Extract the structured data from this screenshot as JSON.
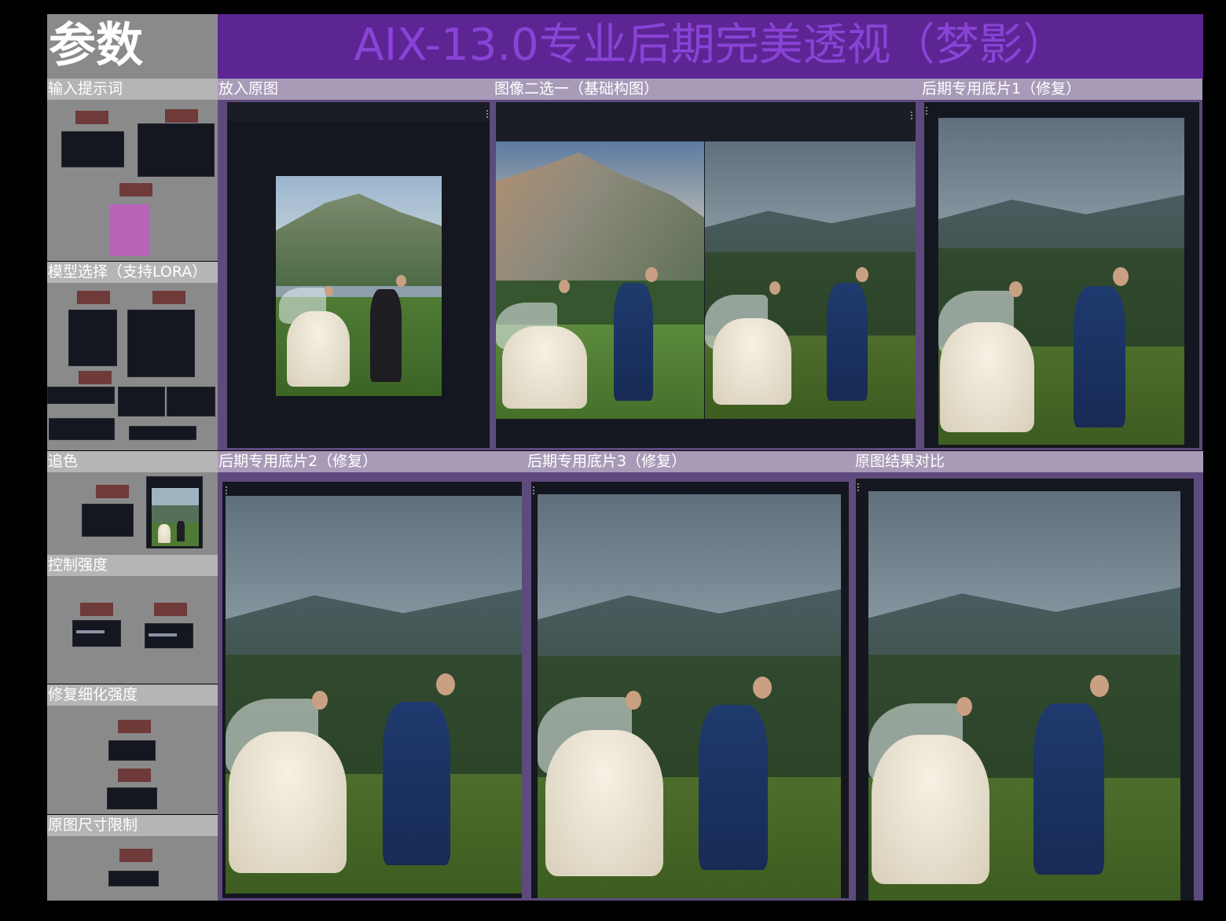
{
  "header": {
    "params_title": "参数",
    "main_title": "AIX-13.0专业后期完美透视（梦影）"
  },
  "params": {
    "input_prompt": "输入提示词",
    "model_select": "模型选择（支持LORA）",
    "color_match": "追色",
    "control_strength": "控制强度",
    "refine_strength": "修复细化强度",
    "size_limit": "原图尺寸限制"
  },
  "sections": {
    "original": "放入原图",
    "choose_one": "图像二选一（基础构图）",
    "base1": "后期专用底片1（修复）",
    "base2": "后期专用底片2（修复）",
    "base3": "后期专用底片3（修复）",
    "compare": "原图结果对比"
  },
  "colors": {
    "header_bg": "#5c2593",
    "title_text": "#8a43d6",
    "param_bg": "#8a8a8a",
    "section_label_bg": "#a89bb8",
    "section_body_bg": "#5e4a7d",
    "node_bg": "#14171f",
    "node_title": "#6e3a3a"
  }
}
